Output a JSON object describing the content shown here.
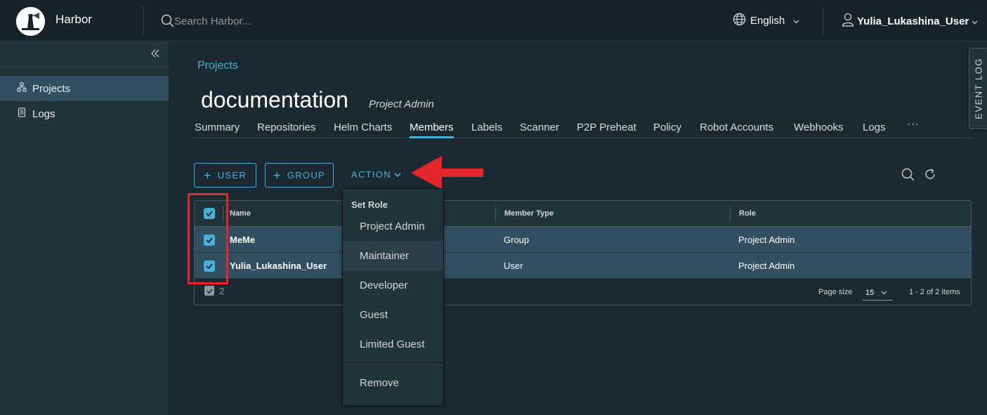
{
  "header": {
    "app_title": "Harbor",
    "search_placeholder": "Search Harbor...",
    "language": "English",
    "username": "Yulia_Lukashina_User"
  },
  "sidebar": {
    "items": [
      {
        "label": "Projects",
        "icon": "project-tree-icon",
        "active": true
      },
      {
        "label": "Logs",
        "icon": "document-icon",
        "active": false
      }
    ]
  },
  "main": {
    "breadcrumb": "Projects",
    "project_name": "documentation",
    "project_role": "Project Admin",
    "tabs": [
      "Summary",
      "Repositories",
      "Helm Charts",
      "Members",
      "Labels",
      "Scanner",
      "P2P Preheat",
      "Policy",
      "Robot Accounts",
      "Webhooks",
      "Logs"
    ],
    "active_tab": "Members",
    "more": "···"
  },
  "toolbar": {
    "user_label": "USER",
    "group_label": "GROUP",
    "action_label": "ACTION"
  },
  "table": {
    "columns": [
      "Name",
      "Member Type",
      "Role"
    ],
    "rows": [
      {
        "name": "MeMe",
        "member_type": "Group",
        "role": "Project Admin",
        "checked": true
      },
      {
        "name": "Yulia_Lukashina_User",
        "member_type": "User",
        "role": "Project Admin",
        "checked": true
      }
    ],
    "selected_count": "2",
    "page_size_label": "Page size",
    "page_size": "15",
    "page_info": "1 - 2 of 2 items"
  },
  "action_menu": {
    "header": "Set Role",
    "roles": [
      "Project Admin",
      "Maintainer",
      "Developer",
      "Guest",
      "Limited Guest"
    ],
    "remove": "Remove"
  },
  "event_log": "EVENT LOG",
  "colors": {
    "accent": "#49afd9",
    "background": "#1b2a32",
    "header": "#17232b",
    "selected_row": "#324f61",
    "annotation_red": "#e5262a"
  }
}
